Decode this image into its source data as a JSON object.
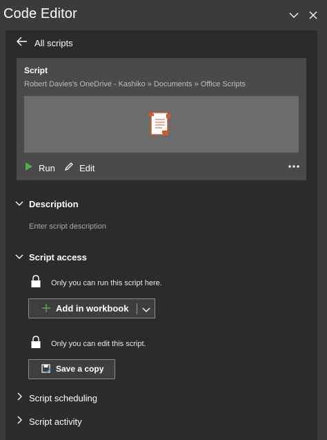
{
  "window": {
    "title": "Code Editor",
    "minimize_icon": "chevron-down-icon",
    "close_icon": "close-icon"
  },
  "nav": {
    "back_label": "All scripts"
  },
  "script_card": {
    "title": "Script",
    "path": "Robert Davies's OneDrive - Kashiko » Documents » Office Scripts",
    "run_label": "Run",
    "edit_label": "Edit",
    "more_icon": "more-horizontal-icon"
  },
  "description": {
    "heading": "Description",
    "placeholder": "Enter script description"
  },
  "script_access": {
    "heading": "Script access",
    "run_info": "Only you can run this script here.",
    "add_button_label": "Add in workbook",
    "edit_info": "Only you can edit this script.",
    "save_copy_label": "Save a copy"
  },
  "collapsed_sections": {
    "scheduling": "Script scheduling",
    "activity": "Script activity"
  },
  "colors": {
    "panel_bg": "#2b2b2b",
    "card_bg": "#4a4a4a",
    "accent_green": "#4caf50",
    "script_icon_orange": "#d9572b"
  }
}
